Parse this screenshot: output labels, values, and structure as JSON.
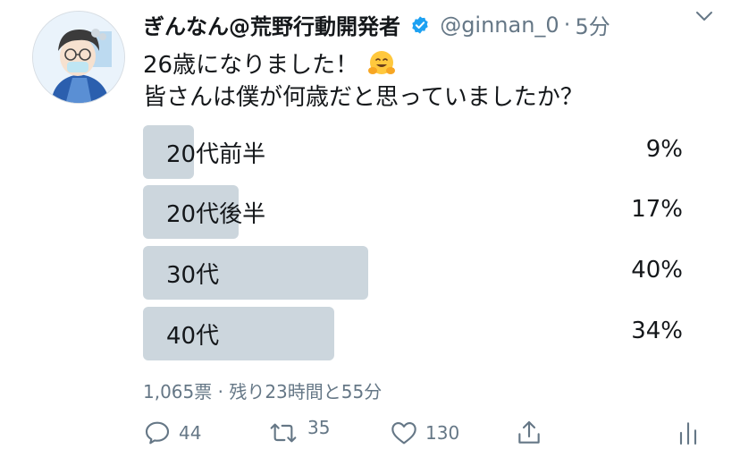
{
  "tweet": {
    "author_name": "ぎんなん@荒野行動開発者",
    "handle": "@ginnan_0",
    "separator": "·",
    "time_ago": "5分",
    "text_line1": "26歳になりました！",
    "text_line2": "皆さんは僕が何歳だと思っていましたか？"
  },
  "poll": {
    "options": [
      {
        "label": "20代前半",
        "percent_text": "9%",
        "percent": 9
      },
      {
        "label": "20代後半",
        "percent_text": "17%",
        "percent": 17
      },
      {
        "label": "30代",
        "percent_text": "40%",
        "percent": 40
      },
      {
        "label": "40代",
        "percent_text": "34%",
        "percent": 34
      }
    ],
    "summary": "1,065票 · 残り23時間と55分"
  },
  "actions": {
    "reply_count": "44",
    "retweet_count": "35",
    "like_count": "130"
  },
  "icons": [
    "verified-badge-icon",
    "chevron-down-icon",
    "hugging-face-emoji",
    "reply-icon",
    "retweet-icon",
    "like-icon",
    "share-icon",
    "analytics-icon"
  ],
  "colors": {
    "bar": "#ccd6dd",
    "verified": "#1da1f2",
    "secondary_text": "#657786"
  }
}
